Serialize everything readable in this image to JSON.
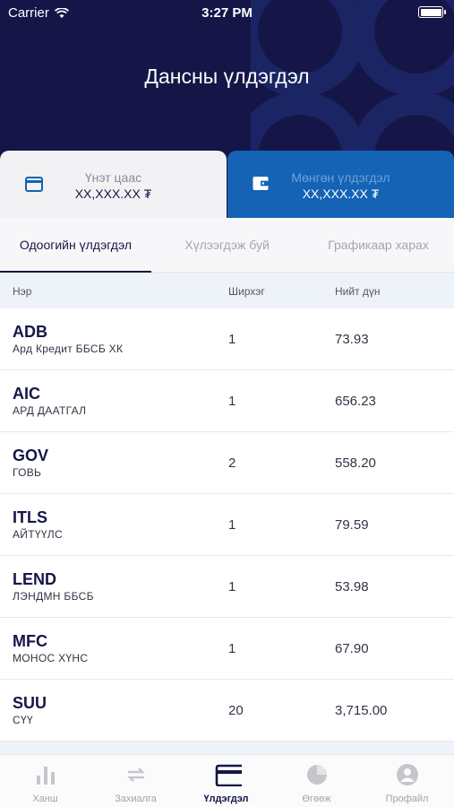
{
  "status_bar": {
    "carrier": "Carrier",
    "time": "3:27 PM"
  },
  "header": {
    "title": "Дансны үлдэгдэл"
  },
  "cards": {
    "securities": {
      "label": "Үнэт цаас",
      "value": "XX,XXX.XX ₮",
      "icon": "card-icon"
    },
    "cash": {
      "label": "Мөнгөн үлдэгдэл",
      "value": "XX,XXX.XX ₮",
      "icon": "wallet-icon"
    }
  },
  "tabs": [
    {
      "label": "Одоогийн үлдэгдэл",
      "active": true
    },
    {
      "label": "Хүлээгдэж буй",
      "active": false
    },
    {
      "label": "Графикаар харах",
      "active": false
    }
  ],
  "table": {
    "headers": {
      "name": "Нэр",
      "qty": "Ширхэг",
      "total": "Нийт дүн"
    },
    "rows": [
      {
        "symbol": "ADB",
        "name": "Ард Кредит ББСБ ХК",
        "qty": "1",
        "total": "73.93"
      },
      {
        "symbol": "AIC",
        "name": "АРД ДААТГАЛ",
        "qty": "1",
        "total": "656.23"
      },
      {
        "symbol": "GOV",
        "name": "ГОВЬ",
        "qty": "2",
        "total": "558.20"
      },
      {
        "symbol": "ITLS",
        "name": "АЙТҮҮЛС",
        "qty": "1",
        "total": "79.59"
      },
      {
        "symbol": "LEND",
        "name": "ЛЭНДМН ББСБ",
        "qty": "1",
        "total": "53.98"
      },
      {
        "symbol": "MFC",
        "name": "МОНОС ХҮНС",
        "qty": "1",
        "total": "67.90"
      },
      {
        "symbol": "SUU",
        "name": "СҮҮ",
        "qty": "20",
        "total": "3,715.00"
      }
    ]
  },
  "tabbar": [
    {
      "label": "Ханш",
      "icon": "bar-chart-icon",
      "active": false
    },
    {
      "label": "Захиалга",
      "icon": "transfer-icon",
      "active": false
    },
    {
      "label": "Үлдэгдэл",
      "icon": "card-icon",
      "active": true
    },
    {
      "label": "Өгөөж",
      "icon": "pie-chart-icon",
      "active": false
    },
    {
      "label": "Профайл",
      "icon": "user-icon",
      "active": false
    }
  ],
  "colors": {
    "header_bg": "#151647",
    "accent_blue": "#1463b5",
    "text_dark": "#151647"
  }
}
